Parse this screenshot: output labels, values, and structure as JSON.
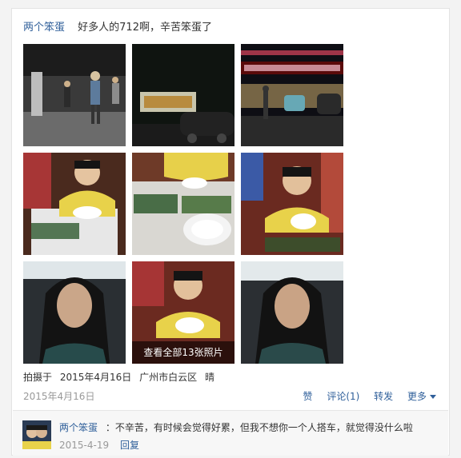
{
  "post": {
    "author": "两个笨蛋",
    "text": "好多人的712啊，辛苦笨蛋了",
    "more_photos": "查看全部13张照片",
    "taken_label": "拍摄于",
    "taken_date": "2015年4月16日",
    "location": "广州市白云区",
    "weather": "晴",
    "post_date": "2015年4月16日",
    "actions": {
      "like": "赞",
      "comment": "评论(1)",
      "share": "转发",
      "more": "更多"
    }
  },
  "photos": [
    {
      "name": "photo-1-street-crowd"
    },
    {
      "name": "photo-2-night-shop"
    },
    {
      "name": "photo-3-restaurant-front"
    },
    {
      "name": "photo-4-boy-eating"
    },
    {
      "name": "photo-5-food-table"
    },
    {
      "name": "photo-6-boy-bowl"
    },
    {
      "name": "photo-7-girl-portrait"
    },
    {
      "name": "photo-8-boy-bowl-2"
    },
    {
      "name": "photo-9-girl-portrait-2"
    }
  ],
  "comment": {
    "author": "两个笨蛋",
    "text": "：不辛苦，有时候会觉得好累，但我不想你一个人搭车，就觉得没什么啦",
    "date": "2015-4-19",
    "reply": "回复"
  }
}
